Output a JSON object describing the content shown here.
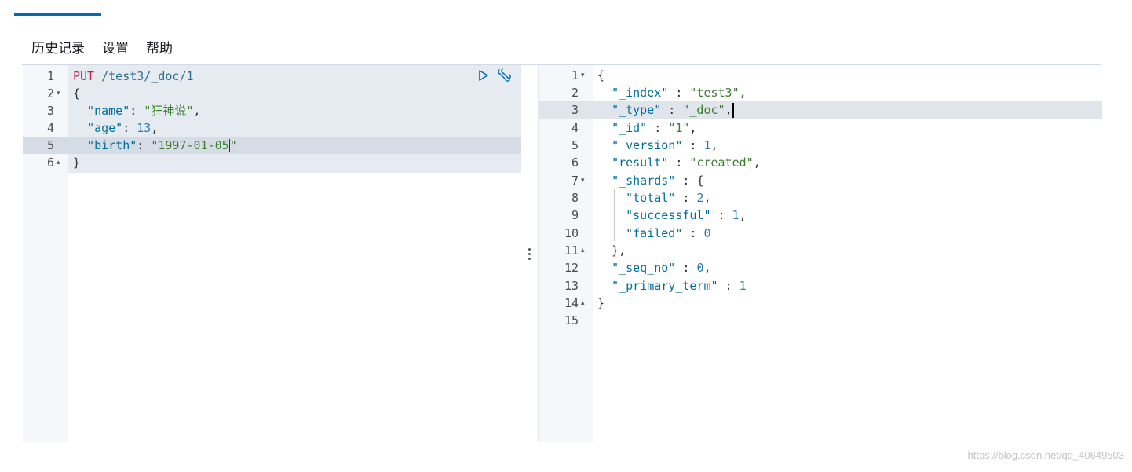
{
  "menu": {
    "history": "历史记录",
    "settings": "设置",
    "help": "帮助"
  },
  "request": {
    "lines": [
      {
        "n": "1",
        "fold": ""
      },
      {
        "n": "2",
        "fold": "▾"
      },
      {
        "n": "3",
        "fold": ""
      },
      {
        "n": "4",
        "fold": ""
      },
      {
        "n": "5",
        "fold": ""
      },
      {
        "n": "6",
        "fold": "▴"
      }
    ],
    "method": "PUT",
    "path": "/test3/_doc/1",
    "open_brace": "{",
    "close_brace": "}",
    "name_key": "\"name\"",
    "name_value": "\"狂神说\"",
    "age_key": "\"age\"",
    "age_value": "13",
    "birth_key": "\"birth\"",
    "birth_value_a": "\"1997-01-05",
    "birth_value_b": "\""
  },
  "response": {
    "line_numbers": [
      "1",
      "2",
      "3",
      "4",
      "5",
      "6",
      "7",
      "8",
      "9",
      "10",
      "11",
      "12",
      "13",
      "14",
      "15"
    ],
    "folds": {
      "1": "▾",
      "7": "▾",
      "11": "▴",
      "14": "▴"
    },
    "index_key": "\"_index\"",
    "index_value": "\"test3\"",
    "type_key": "\"_type\"",
    "type_value": "\"_doc\"",
    "id_key": "\"_id\"",
    "id_value": "\"1\"",
    "version_key": "\"_version\"",
    "version_value": "1",
    "result_key": "\"result\"",
    "result_value": "\"created\"",
    "shards_key": "\"_shards\"",
    "total_key": "\"total\"",
    "total_value": "2",
    "successful_key": "\"successful\"",
    "successful_value": "1",
    "failed_key": "\"failed\"",
    "failed_value": "0",
    "seq_no_key": "\"_seq_no\"",
    "seq_no_value": "0",
    "primary_term_key": "\"_primary_term\"",
    "primary_term_value": "1"
  },
  "watermark": "https://blog.csdn.net/qq_40649503",
  "colors": {
    "accent": "#006bb4",
    "method": "#c7254e",
    "string": "#3c7d2f",
    "key": "#006f9e",
    "number": "#2a7dae"
  },
  "icons": {
    "run": "play-icon",
    "wrench": "wrench-icon"
  }
}
